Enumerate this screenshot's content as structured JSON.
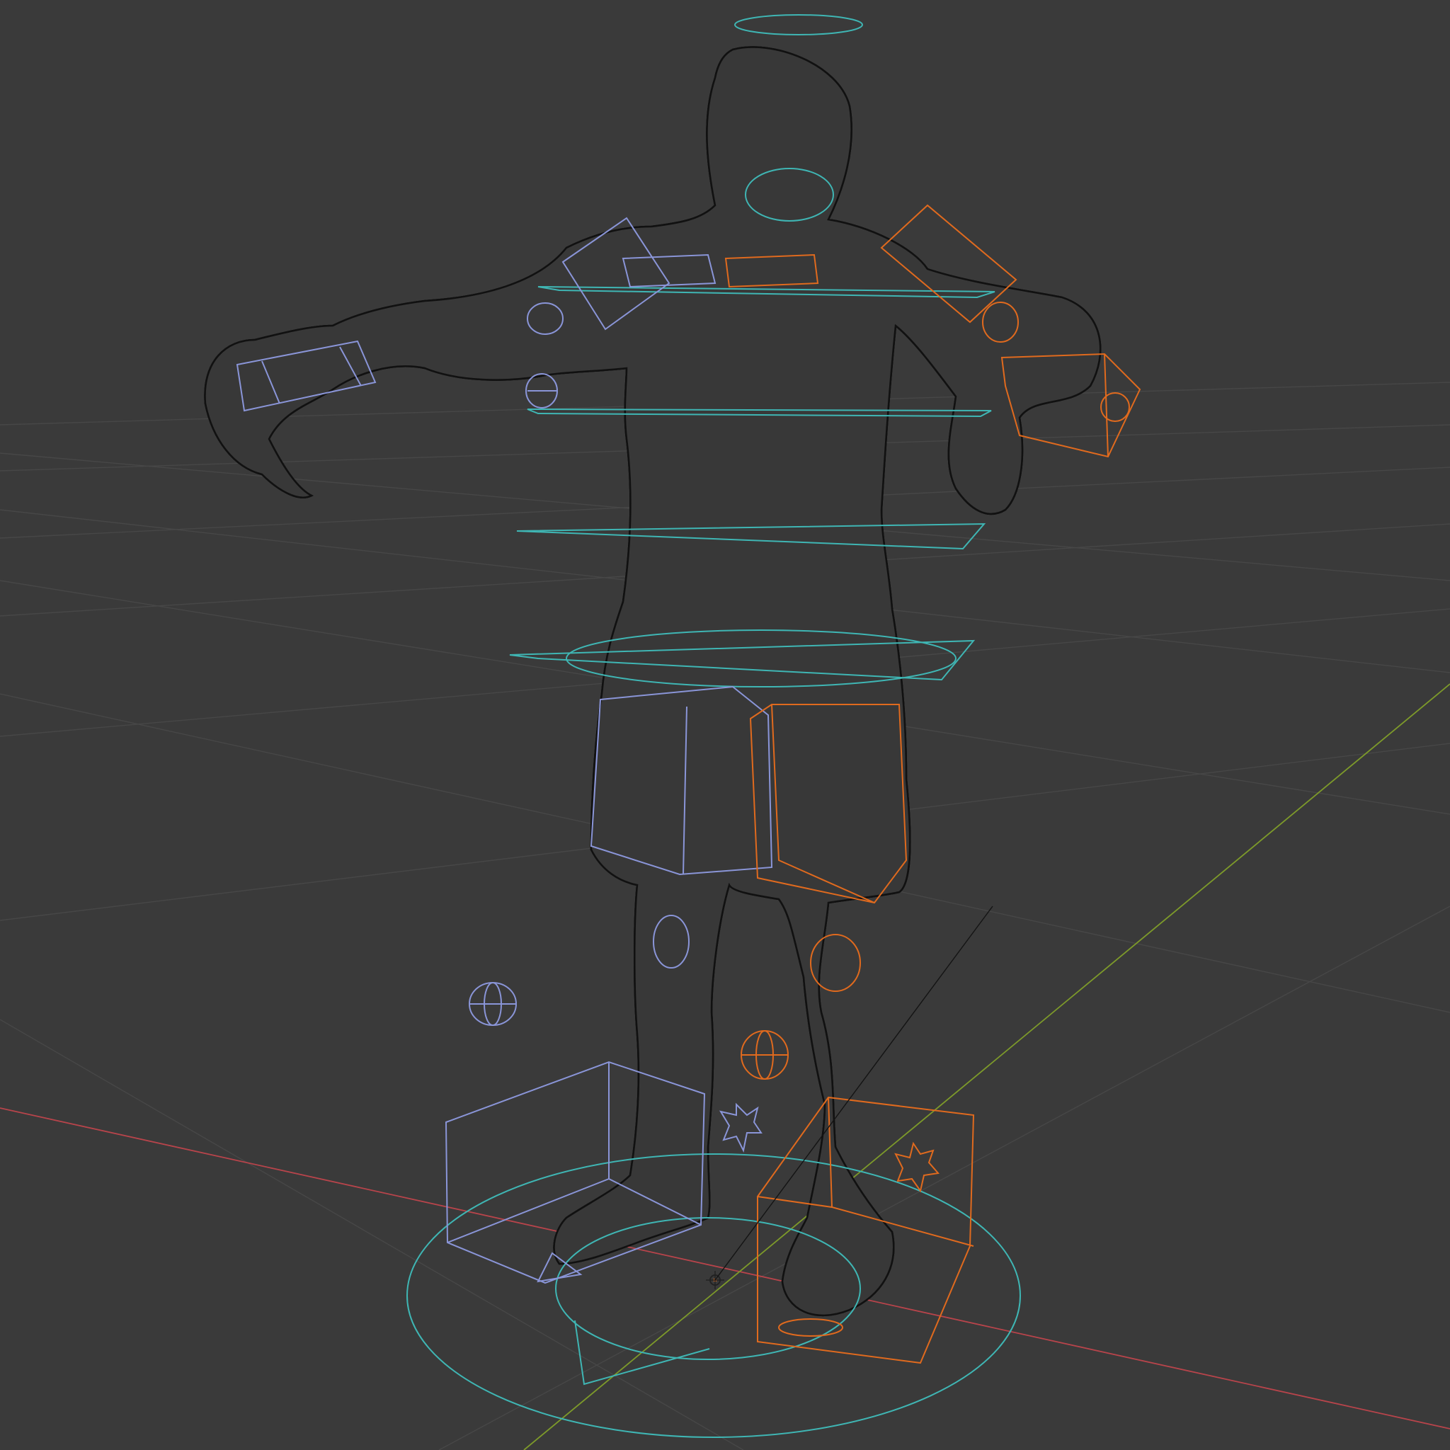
{
  "viewport": {
    "mode": "wireframe",
    "background": "#3a3a3a",
    "grid_color": "#4a4a4a",
    "x_axis_color": "#c0444c",
    "y_axis_color": "#7f9a2c",
    "mesh_color": "#141414"
  },
  "rig": {
    "control_colors": {
      "left_side": "#8a95d8",
      "right_side": "#e06a1e",
      "center": "#3fb6b4"
    },
    "controls": [
      {
        "name": "head-ring",
        "side": "center"
      },
      {
        "name": "neck-ring",
        "side": "center"
      },
      {
        "name": "chest-ring",
        "side": "center"
      },
      {
        "name": "spine-ring",
        "side": "center"
      },
      {
        "name": "hips-ring",
        "side": "center"
      },
      {
        "name": "root-ring",
        "side": "center"
      },
      {
        "name": "shoulder-left",
        "side": "left"
      },
      {
        "name": "shoulder-right",
        "side": "right"
      },
      {
        "name": "hand-left",
        "side": "left"
      },
      {
        "name": "hand-right",
        "side": "right"
      },
      {
        "name": "thigh-left",
        "side": "left"
      },
      {
        "name": "thigh-right",
        "side": "right"
      },
      {
        "name": "foot-left",
        "side": "left"
      },
      {
        "name": "foot-right",
        "side": "right"
      }
    ]
  }
}
